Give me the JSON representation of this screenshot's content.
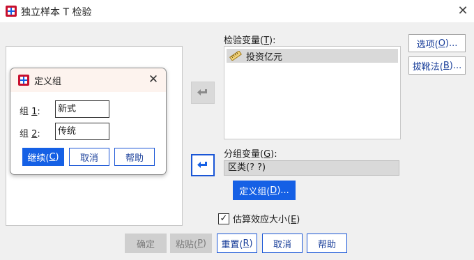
{
  "window": {
    "title": "独立样本 T 检验",
    "close_glyph": "✕"
  },
  "main": {
    "test_var_label": "检验变量(",
    "test_var_key": "T",
    "test_var_suffix": "):",
    "test_var_item": "投资亿元",
    "group_var_label": "分组变量(",
    "group_var_key": "G",
    "group_var_suffix": "):",
    "group_var_value": "区类(? ?)",
    "define_groups_button": "定义组(",
    "define_groups_key": "D",
    "define_groups_suffix": ")...",
    "effect_size_label": "估算效应大小(",
    "effect_size_key": "E",
    "effect_size_suffix": ")",
    "effect_size_checked": true,
    "check_glyph": "✓"
  },
  "side_buttons": {
    "options_label": "选项(",
    "options_key": "O",
    "options_suffix": ")...",
    "bootstrap_label": "拔靴法(",
    "bootstrap_key": "B",
    "bootstrap_suffix": ")..."
  },
  "bottom_buttons": {
    "ok": "确定",
    "paste_label": "粘贴(",
    "paste_key": "P",
    "paste_suffix": ")",
    "reset_label": "重置(",
    "reset_key": "R",
    "reset_suffix": ")",
    "cancel": "取消",
    "help": "帮助"
  },
  "define_dialog": {
    "title": "定义组",
    "close_glyph": "✕",
    "group1_label_prefix": "组 ",
    "group1_label_key": "1",
    "group1_label_suffix": ":",
    "group1_value": "新式",
    "group2_label_prefix": "组 ",
    "group2_label_key": "2",
    "group2_label_suffix": ":",
    "group2_value": "传统",
    "continue_label": "继续(",
    "continue_key": "C",
    "continue_suffix": ")",
    "cancel": "取消",
    "help": "帮助"
  },
  "colors": {
    "accent": "#1560e5",
    "link_text": "#1a3f9a",
    "disabled_bg": "#cfcfcf",
    "selection_bg": "#d9d9d9"
  }
}
